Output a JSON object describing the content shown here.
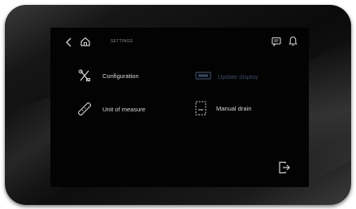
{
  "header": {
    "breadcrumb": "SETTINGS"
  },
  "icons": {
    "back": "chevron-left-icon",
    "home": "home-icon",
    "message": "message-icon",
    "notification": "bell-icon",
    "logout": "logout-icon"
  },
  "menu": {
    "items": [
      {
        "label": "Configuration",
        "icon": "tools-icon",
        "enabled": true
      },
      {
        "label": "Update display",
        "icon": "display-update-icon",
        "enabled": false
      },
      {
        "label": "Unit of measure",
        "icon": "ruler-icon",
        "enabled": true
      },
      {
        "label": "Manual drain",
        "icon": "drain-icon",
        "enabled": true
      }
    ]
  },
  "colors": {
    "screen_background": "#030303",
    "text": "#d8d8d8",
    "disabled_text": "#3b4a62",
    "icon": "#d0d0d0"
  }
}
